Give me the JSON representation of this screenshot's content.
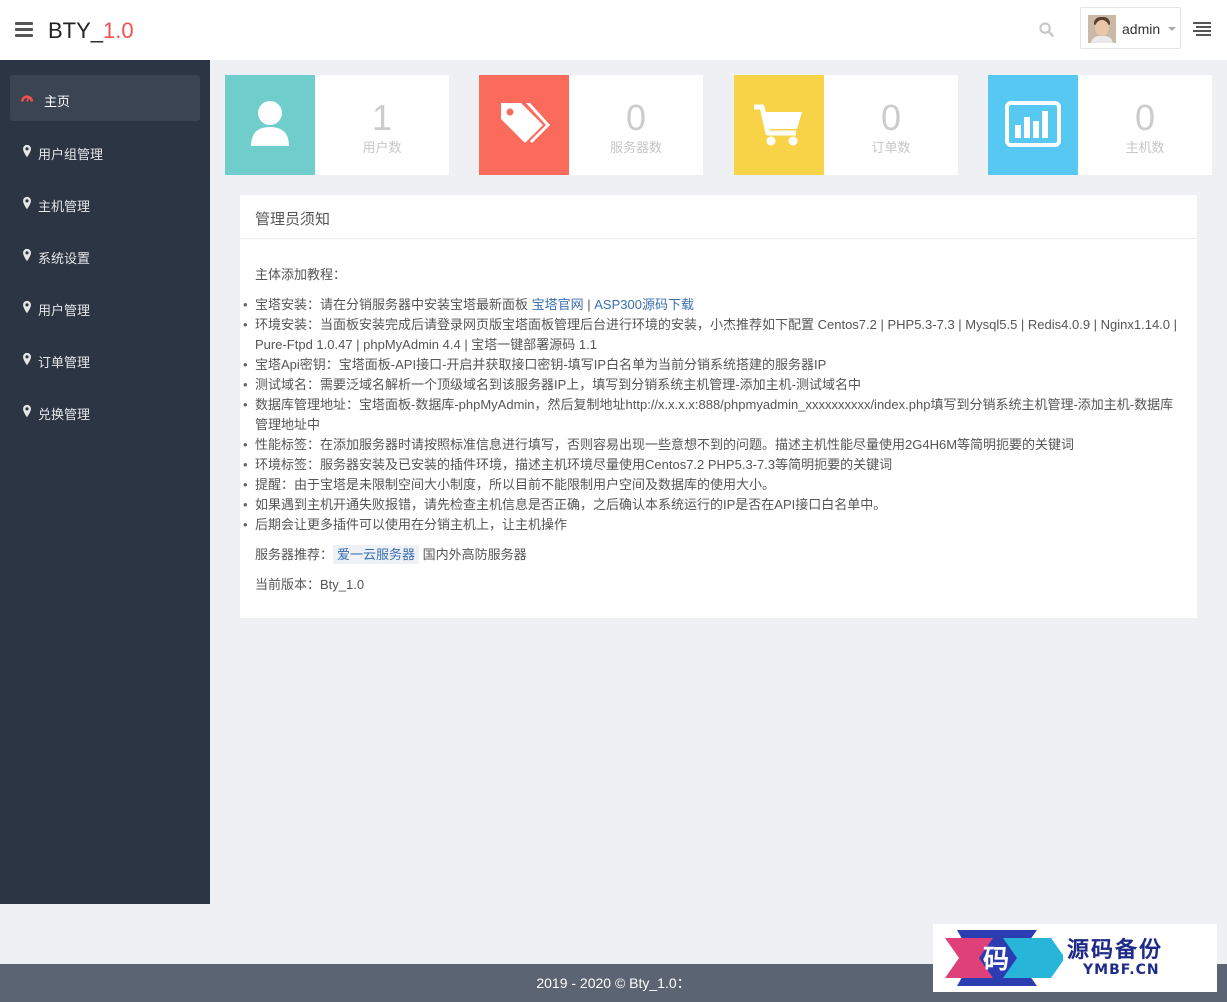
{
  "header": {
    "brand_main": "BTY_",
    "brand_version": "1.0",
    "user_name": "admin"
  },
  "sidebar": {
    "items": [
      {
        "label": "主页",
        "icon": "dashboard-icon",
        "active": true
      },
      {
        "label": "用户组管理",
        "icon": "map-marker-icon"
      },
      {
        "label": "主机管理",
        "icon": "map-marker-icon"
      },
      {
        "label": "系统设置",
        "icon": "map-marker-icon"
      },
      {
        "label": "用户管理",
        "icon": "map-marker-icon"
      },
      {
        "label": "订单管理",
        "icon": "map-marker-icon"
      },
      {
        "label": "兑换管理",
        "icon": "map-marker-icon"
      }
    ]
  },
  "stats": [
    {
      "value": "1",
      "label": "用户数",
      "color": "#6fcdcb",
      "icon": "user-icon"
    },
    {
      "value": "0",
      "label": "服务器数",
      "color": "#fb6b5b",
      "icon": "tags-icon"
    },
    {
      "value": "0",
      "label": "订单数",
      "color": "#f8d347",
      "icon": "cart-icon"
    },
    {
      "value": "0",
      "label": "主机数",
      "color": "#57c8f1",
      "icon": "bar-chart-icon"
    }
  ],
  "notice": {
    "title": "管理员须知",
    "intro": "主体添加教程：",
    "item1_prefix": "宝塔安装：请在分销服务器中安装宝塔最新面板 ",
    "item1_link1": "宝塔官网",
    "item1_sep": " | ",
    "item1_link2": "ASP300源码下载",
    "item2": "环境安装：当面板安装完成后请登录网页版宝塔面板管理后台进行环境的安装，小杰推荐如下配置 Centos7.2 | PHP5.3-7.3 | Mysql5.5 | Redis4.0.9 | Nginx1.14.0 | Pure-Ftpd 1.0.47 | phpMyAdmin 4.4 | 宝塔一键部署源码 1.1",
    "item3": "宝塔Api密钥：宝塔面板-API接口-开启并获取接口密钥-填写IP白名单为当前分销系统搭建的服务器IP",
    "item4": "测试域名：需要泛域名解析一个顶级域名到该服务器IP上，填写到分销系统主机管理-添加主机-测试域名中",
    "item5": "数据库管理地址：宝塔面板-数据库-phpMyAdmin，然后复制地址http://x.x.x.x:888/phpmyadmin_xxxxxxxxxx/index.php填写到分销系统主机管理-添加主机-数据库管理地址中",
    "item6": "性能标签：在添加服务器时请按照标准信息进行填写，否则容易出现一些意想不到的问题。描述主机性能尽量使用2G4H6M等简明扼要的关键词",
    "item7": "环境标签：服务器安装及已安装的插件环境，描述主机环境尽量使用Centos7.2 PHP5.3-7.3等简明扼要的关键词",
    "item8": "提醒：由于宝塔是未限制空间大小制度，所以目前不能限制用户空间及数据库的使用大小。",
    "item9": "如果遇到主机开通失败报错，请先检查主机信息是否正确，之后确认本系统运行的IP是否在API接口白名单中。",
    "item10": "后期会让更多插件可以使用在分销主机上，让主机操作",
    "recommend_prefix": "服务器推荐：",
    "recommend_tag": "爱一云服务器",
    "recommend_suffix": " 国内外高防服务器",
    "version": "当前版本：Bty_1.0"
  },
  "footer": {
    "text": "2019 - 2020 © Bty_1.0："
  },
  "watermark": {
    "char": "码",
    "title": "源码备份",
    "sub": "YMBF.CN"
  }
}
